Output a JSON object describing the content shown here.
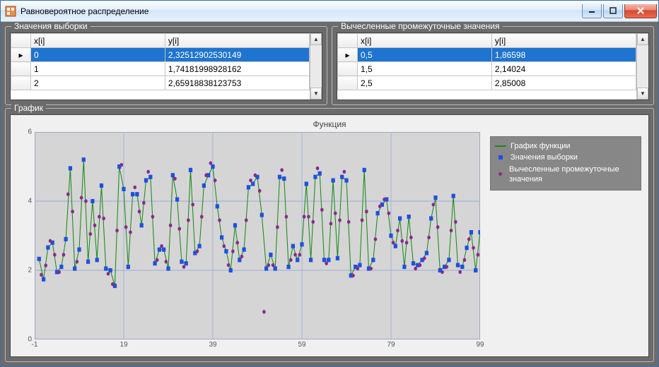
{
  "window": {
    "title": "Равновероятное распределение"
  },
  "groups": {
    "sample_title": "Значения выборки",
    "computed_title": "Вычесленные промежуточные значения",
    "chart_title": "График"
  },
  "grid_headers": {
    "x": "x[i]",
    "y": "y[i]"
  },
  "sample_rows": [
    {
      "x": "0",
      "y": "2,32512902530149"
    },
    {
      "x": "1",
      "y": "1,74181998928162"
    },
    {
      "x": "2",
      "y": "2,65918838123753"
    }
  ],
  "computed_rows": [
    {
      "x": "0,5",
      "y": "1,86598"
    },
    {
      "x": "1,5",
      "y": "2,14024"
    },
    {
      "x": "2,5",
      "y": "2,85008"
    }
  ],
  "chart": {
    "title": "Функция",
    "legend": {
      "line": "График функции",
      "squares": "Значения выборки",
      "dots": "Вычесленные промежуточные значения"
    }
  },
  "chart_data": {
    "type": "scatter",
    "xlabel": "",
    "ylabel": "",
    "xlim": [
      -1,
      99
    ],
    "ylim": [
      0,
      6
    ],
    "x_ticks": [
      -1,
      19,
      39,
      59,
      79,
      99
    ],
    "y_ticks": [
      0,
      2,
      4,
      6
    ],
    "series": [
      {
        "name": "Значения выборки",
        "style": "square",
        "x": [
          0,
          1,
          2,
          3,
          4,
          5,
          6,
          7,
          8,
          9,
          10,
          11,
          12,
          13,
          14,
          15,
          16,
          17,
          18,
          19,
          20,
          21,
          22,
          23,
          24,
          25,
          26,
          27,
          28,
          29,
          30,
          31,
          32,
          33,
          34,
          35,
          36,
          37,
          38,
          39,
          40,
          41,
          42,
          43,
          44,
          45,
          46,
          47,
          48,
          49,
          50,
          51,
          52,
          53,
          54,
          55,
          56,
          57,
          58,
          59,
          60,
          61,
          62,
          63,
          64,
          65,
          66,
          67,
          68,
          69,
          70,
          71,
          72,
          73,
          74,
          75,
          76,
          77,
          78,
          79,
          80,
          81,
          82,
          83,
          84,
          85,
          86,
          87,
          88,
          89,
          90,
          91,
          92,
          93,
          94,
          95,
          96,
          97,
          98,
          99
        ],
        "y": [
          2.33,
          1.74,
          2.66,
          2.8,
          1.95,
          2.1,
          2.9,
          4.95,
          2.05,
          2.6,
          5.2,
          2.25,
          4.0,
          2.3,
          4.45,
          2.05,
          2.0,
          1.55,
          5.0,
          4.35,
          2.1,
          4.2,
          4.2,
          3.3,
          4.6,
          4.7,
          2.2,
          2.6,
          2.6,
          2.05,
          4.75,
          4.05,
          2.25,
          2.2,
          4.9,
          2.5,
          2.7,
          4.45,
          4.75,
          5.0,
          3.85,
          2.95,
          2.55,
          2.0,
          3.3,
          2.3,
          2.6,
          4.4,
          4.5,
          4.7,
          3.6,
          2.05,
          2.45,
          2.05,
          4.7,
          4.65,
          2.1,
          2.7,
          2.3,
          2.75,
          4.5,
          2.3,
          4.7,
          4.8,
          2.3,
          2.3,
          4.6,
          2.35,
          4.7,
          4.6,
          1.85,
          2.1,
          2.15,
          4.9,
          2.05,
          2.3,
          3.65,
          3.9,
          4.05,
          3.0,
          2.7,
          3.5,
          2.1,
          3.55,
          2.2,
          2.15,
          2.3,
          2.5,
          3.5,
          4.1,
          2.0,
          2.1,
          2.3,
          4.15,
          2.15,
          2.1,
          2.65,
          3.1,
          2.0,
          3.1
        ]
      },
      {
        "name": "Вычесленные промежуточные значения",
        "style": "circle",
        "x": [
          0.5,
          1.5,
          2.5,
          3.5,
          4.5,
          5.5,
          6.5,
          7.5,
          8.5,
          9.5,
          10.5,
          11.5,
          12.5,
          13.5,
          14.5,
          15.5,
          16.5,
          17.5,
          18.5,
          19.5,
          20.5,
          21.5,
          22.5,
          23.5,
          24.5,
          25.5,
          26.5,
          27.5,
          28.5,
          29.5,
          30.5,
          31.5,
          32.5,
          33.5,
          34.5,
          35.5,
          36.5,
          37.5,
          38.5,
          39.5,
          40.5,
          41.5,
          42.5,
          43.5,
          44.5,
          45.5,
          46.5,
          47.5,
          48.5,
          49.5,
          50.5,
          51.5,
          52.5,
          53.5,
          54.5,
          55.5,
          56.5,
          57.5,
          58.5,
          59.5,
          60.5,
          61.5,
          62.5,
          63.5,
          64.5,
          65.5,
          66.5,
          67.5,
          68.5,
          69.5,
          70.5,
          71.5,
          72.5,
          73.5,
          74.5,
          75.5,
          76.5,
          77.5,
          78.5,
          79.5,
          80.5,
          81.5,
          82.5,
          83.5,
          84.5,
          85.5,
          86.5,
          87.5,
          88.5,
          89.5,
          90.5,
          91.5,
          92.5,
          93.5,
          94.5,
          95.5,
          96.5,
          97.5,
          98.5
        ],
        "y": [
          1.87,
          2.14,
          2.85,
          2.45,
          1.95,
          2.45,
          4.2,
          3.7,
          2.25,
          4.1,
          4.0,
          3.05,
          3.3,
          3.55,
          3.5,
          1.9,
          1.6,
          3.15,
          5.05,
          3.25,
          3.1,
          4.4,
          3.7,
          3.95,
          4.85,
          3.55,
          2.3,
          2.7,
          2.25,
          3.3,
          4.65,
          3.2,
          2.1,
          3.45,
          3.9,
          2.55,
          3.55,
          4.75,
          5.1,
          4.6,
          3.45,
          2.7,
          2.15,
          2.55,
          2.8,
          2.4,
          3.45,
          4.6,
          4.75,
          4.3,
          0.8,
          2.15,
          2.15,
          3.25,
          4.9,
          3.55,
          2.3,
          2.45,
          2.45,
          3.55,
          3.55,
          3.4,
          4.95,
          3.75,
          2.2,
          3.35,
          3.65,
          3.45,
          4.85,
          3.4,
          1.85,
          2.05,
          3.45,
          3.7,
          2.05,
          2.9,
          3.85,
          4.05,
          3.65,
          2.8,
          3.15,
          2.85,
          2.8,
          2.95,
          2.05,
          2.15,
          2.35,
          2.95,
          3.9,
          3.25,
          1.95,
          2.1,
          3.15,
          3.4,
          1.95,
          2.3,
          2.9,
          2.65,
          2.45
        ]
      },
      {
        "name": "График функции",
        "style": "line",
        "note": "line drawn through sample points (same x,y as first series)"
      }
    ]
  }
}
